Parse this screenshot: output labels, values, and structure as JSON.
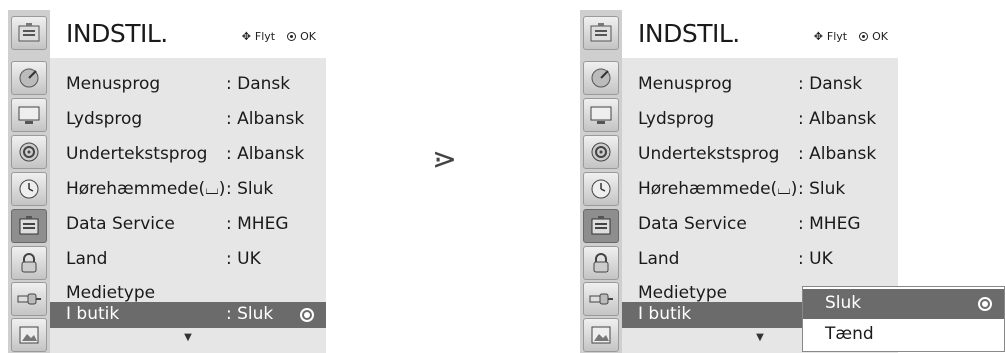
{
  "menu": {
    "title": "INDSTIL.",
    "nav_move": "Flyt",
    "nav_ok": "OK",
    "icons": [
      "satellite-dish-icon",
      "monitor-icon",
      "speaker-icon",
      "clock-icon",
      "settings-box-icon",
      "lock-icon",
      "connector-icon",
      "picture-icon"
    ],
    "active_icon_index": 4,
    "items": [
      {
        "label": "Menusprog",
        "value": ": Dansk"
      },
      {
        "label": "Lydsprog",
        "value": ": Albansk"
      },
      {
        "label": "Undertekstsprog",
        "value": ": Albansk"
      },
      {
        "label": "Hørehæmmede(⌴)",
        "value": ": Sluk"
      },
      {
        "label": "Data Service",
        "value": ": MHEG"
      },
      {
        "label": "Land",
        "value": ": UK"
      },
      {
        "label": "Medietype",
        "value": ""
      },
      {
        "label": "I butik",
        "value": ": Sluk"
      }
    ],
    "scroll_indicator": "▼"
  },
  "transition_symbol": "⋗",
  "popup": {
    "options": [
      "Sluk",
      "Tænd"
    ],
    "selected_index": 0
  }
}
